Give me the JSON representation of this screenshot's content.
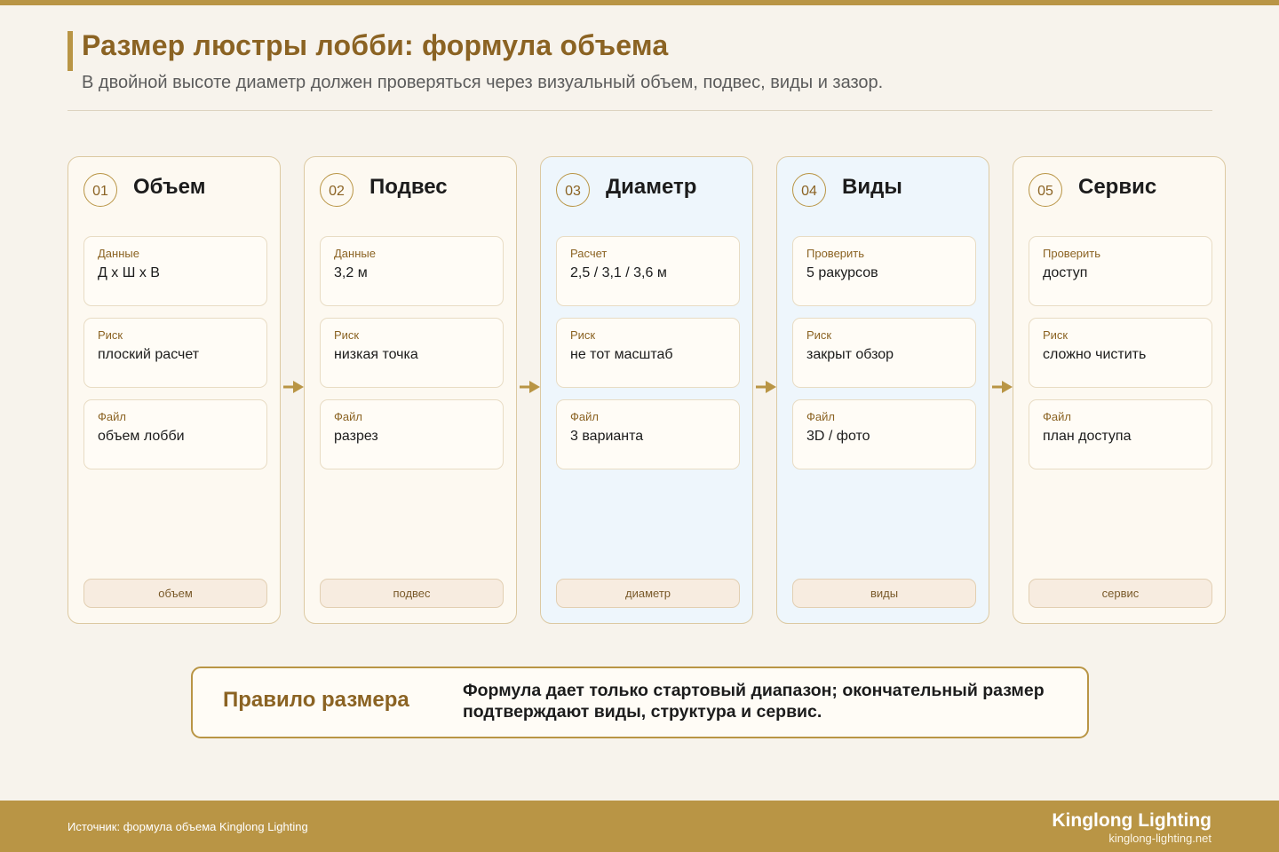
{
  "header": {
    "title": "Размер люстры лобби: формула объема",
    "subtitle": "В двойной высоте диаметр должен проверяться через визуальный объем, подвес, виды и зазор."
  },
  "colors": {
    "accent": "#b99545",
    "title": "#8b6323",
    "card_bg": "#fdf9f1",
    "card_highlight_bg": "#eef6fc",
    "page_bg": "#f7f3ec"
  },
  "icons": {
    "arrow": "arrow-right-icon"
  },
  "steps": [
    {
      "num": "01",
      "title": "Объем",
      "highlight": false,
      "fields": [
        {
          "label": "Данные",
          "value": "Д x Ш x В"
        },
        {
          "label": "Риск",
          "value": "плоский расчет"
        },
        {
          "label": "Файл",
          "value": "объем лобби"
        }
      ],
      "tag": "объем"
    },
    {
      "num": "02",
      "title": "Подвес",
      "highlight": false,
      "fields": [
        {
          "label": "Данные",
          "value": "3,2 м"
        },
        {
          "label": "Риск",
          "value": "низкая точка"
        },
        {
          "label": "Файл",
          "value": "разрез"
        }
      ],
      "tag": "подвес"
    },
    {
      "num": "03",
      "title": "Диаметр",
      "highlight": true,
      "fields": [
        {
          "label": "Расчет",
          "value": "2,5 / 3,1 / 3,6 м"
        },
        {
          "label": "Риск",
          "value": "не тот масштаб"
        },
        {
          "label": "Файл",
          "value": "3 варианта"
        }
      ],
      "tag": "диаметр"
    },
    {
      "num": "04",
      "title": "Виды",
      "highlight": true,
      "fields": [
        {
          "label": "Проверить",
          "value": "5 ракурсов"
        },
        {
          "label": "Риск",
          "value": "закрыт обзор"
        },
        {
          "label": "Файл",
          "value": "3D / фото"
        }
      ],
      "tag": "виды"
    },
    {
      "num": "05",
      "title": "Сервис",
      "highlight": false,
      "fields": [
        {
          "label": "Проверить",
          "value": "доступ"
        },
        {
          "label": "Риск",
          "value": "сложно чистить"
        },
        {
          "label": "Файл",
          "value": "план доступа"
        }
      ],
      "tag": "сервис"
    }
  ],
  "rule": {
    "label": "Правило размера",
    "text": "Формула дает только стартовый диапазон; окончательный размер подтверждают виды, структура и сервис."
  },
  "footer": {
    "source": "Источник: формула объема Kinglong Lighting",
    "brand": "Kinglong Lighting",
    "url": "kinglong-lighting.net"
  }
}
